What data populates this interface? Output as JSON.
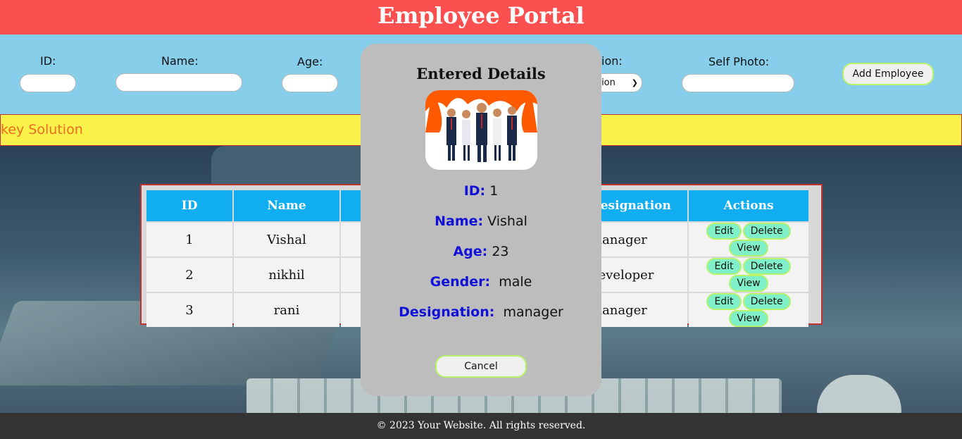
{
  "header": {
    "title": "Employee Portal"
  },
  "form": {
    "id_label": "ID:",
    "name_label": "Name:",
    "age_label": "Age:",
    "designation_label_partial": "ion:",
    "designation_select_partial": "ation",
    "photo_label": "Self Photo:",
    "add_button": "Add Employee"
  },
  "marquee": {
    "text": "nkey Solution"
  },
  "table": {
    "headers": [
      "ID",
      "Name",
      "",
      "Designation",
      "Actions"
    ],
    "rows": [
      {
        "id": "1",
        "name": "Vishal",
        "designation": "manager"
      },
      {
        "id": "2",
        "name": "nikhil",
        "designation": "developer"
      },
      {
        "id": "3",
        "name": "rani",
        "designation": "manager"
      }
    ],
    "actions": {
      "edit": "Edit",
      "delete": "Delete",
      "view": "View"
    }
  },
  "modal": {
    "title": "Entered Details",
    "id_key": "ID:",
    "id_val": "1",
    "name_key": "Name:",
    "name_val": "Vishal",
    "age_key": "Age:",
    "age_val": "23",
    "gender_key": "Gender:",
    "gender_val": "male",
    "designation_key": "Designation:",
    "designation_val": "manager",
    "cancel": "Cancel"
  },
  "footer": {
    "text": "© 2023 Your Website. All rights reserved."
  },
  "colors": {
    "header_bg": "#fc4f4f",
    "form_bg": "#87ceeb",
    "marquee_bg": "#f9f24a",
    "table_header": "#10aef0",
    "modal_bg": "#bdbdbd",
    "action_btn": "#7ff0c8",
    "footer_bg": "#333333"
  }
}
